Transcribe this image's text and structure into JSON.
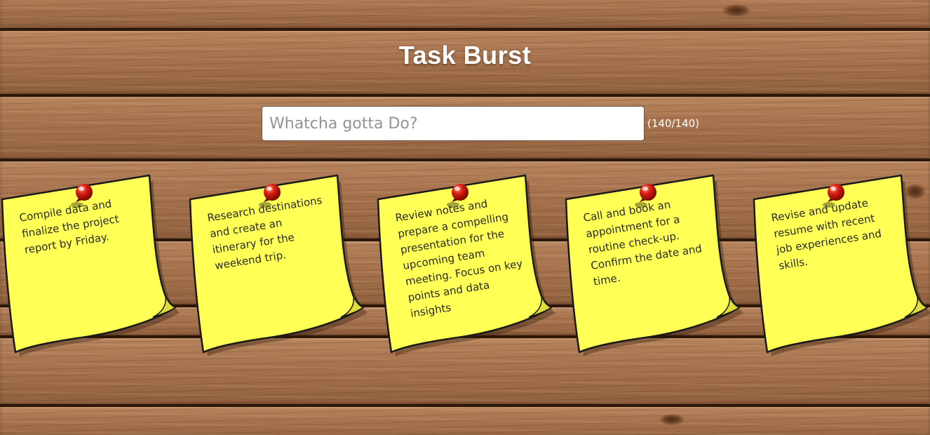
{
  "app": {
    "title": "Task Burst"
  },
  "input": {
    "placeholder": "Whatcha gotta Do?",
    "value": "",
    "char_counter": "(140/140)"
  },
  "notes": [
    {
      "text": "Compile data and finalize the project report by Friday."
    },
    {
      "text": "Research destinations and create an itinerary for the weekend trip."
    },
    {
      "text": "Review notes and prepare a compelling presentation for the upcoming team meeting. Focus on key points and data insights"
    },
    {
      "text": "Call and book an appointment for a routine check-up. Confirm the date and time."
    },
    {
      "text": "Revise and update resume with recent job experiences and skills."
    }
  ],
  "colors": {
    "note_yellow": "#ffff55",
    "pin_red": "#d81b10",
    "title_text": "#ffffff",
    "wood": "#a06f4a"
  },
  "icons": {
    "pin": "pushpin-icon"
  }
}
